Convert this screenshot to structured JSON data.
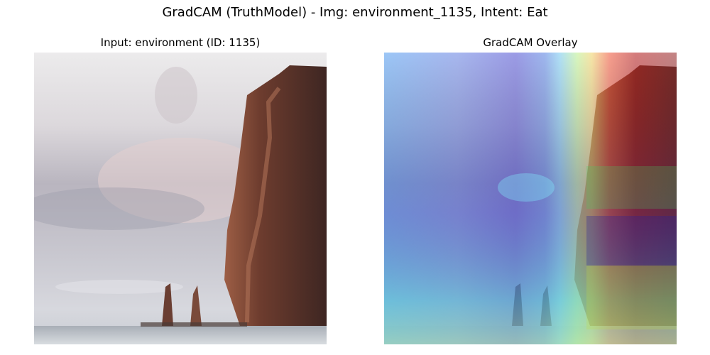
{
  "figure": {
    "suptitle": "GradCAM (TruthModel) - Img: environment_1135, Intent: Eat"
  },
  "panels": [
    {
      "title": "Input: environment (ID: 1135)",
      "content": "photo of sea cliff with two sea stacks"
    },
    {
      "title": "GradCAM Overlay",
      "content": "photo with jet-colormap heatmap overlay"
    }
  ]
}
